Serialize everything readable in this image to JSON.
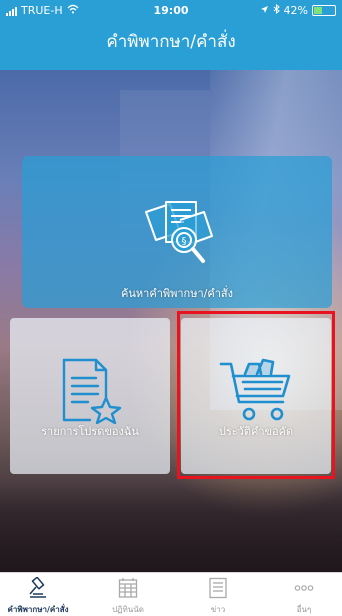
{
  "status_bar": {
    "carrier": "TRUE-H",
    "time": "19:00",
    "battery": "42%",
    "battery_level": 0.42
  },
  "header": {
    "title": "คำพิพากษา/คำสั่ง"
  },
  "tiles": {
    "search": {
      "label": "ค้นหาคำพิพากษา/คำสั่ง"
    },
    "favorites": {
      "label": "รายการโปรดของฉัน"
    },
    "history": {
      "label": "ประวัติคำขอคัด"
    }
  },
  "tabbar": {
    "items": [
      {
        "label": "คำพิพากษา/คำสั่ง",
        "icon": "gavel-icon",
        "active": true
      },
      {
        "label": "ปฏิทินนัด",
        "icon": "calendar-icon",
        "active": false
      },
      {
        "label": "ข่าว",
        "icon": "news-icon",
        "active": false
      },
      {
        "label": "อื่นๆ",
        "icon": "more-icon",
        "active": false
      }
    ]
  },
  "colors": {
    "primary": "#2a9fd6",
    "highlight": "#e8131f",
    "icon": "#1f8fcf"
  }
}
